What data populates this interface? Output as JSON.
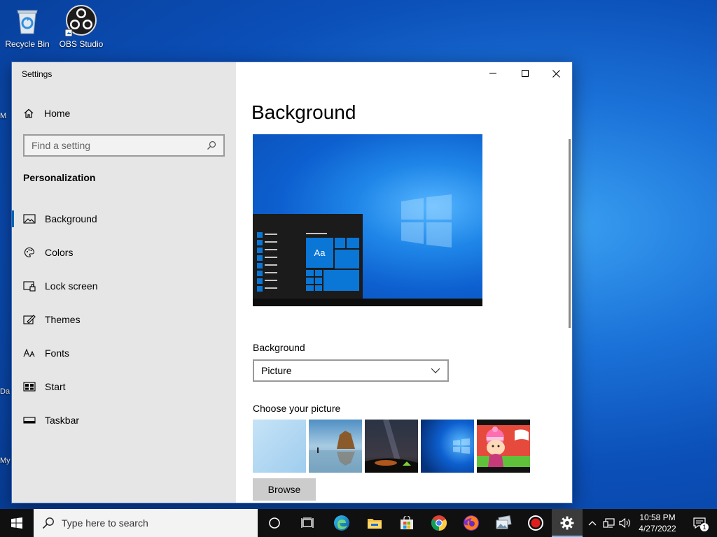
{
  "desktop": {
    "icons": [
      {
        "label": "Recycle Bin",
        "icon": "recycle-bin-icon"
      },
      {
        "label": "OBS Studio",
        "icon": "obs-studio-icon"
      }
    ],
    "edge_labels": [
      "M",
      "Da",
      "My"
    ]
  },
  "window": {
    "title": "Settings",
    "controls": {
      "minimize": "minimize-icon",
      "maximize": "maximize-icon",
      "close": "close-icon"
    }
  },
  "sidebar": {
    "home_label": "Home",
    "search_placeholder": "Find a setting",
    "section_title": "Personalization",
    "items": [
      {
        "label": "Background",
        "icon": "picture-icon",
        "active": true
      },
      {
        "label": "Colors",
        "icon": "palette-icon",
        "active": false
      },
      {
        "label": "Lock screen",
        "icon": "lock-screen-icon",
        "active": false
      },
      {
        "label": "Themes",
        "icon": "themes-icon",
        "active": false
      },
      {
        "label": "Fonts",
        "icon": "fonts-icon",
        "active": false
      },
      {
        "label": "Start",
        "icon": "start-icon",
        "active": false
      },
      {
        "label": "Taskbar",
        "icon": "taskbar-icon",
        "active": false
      }
    ]
  },
  "main": {
    "page_title": "Background",
    "preview_tile_text": "Aa",
    "background_label": "Background",
    "background_value": "Picture",
    "choose_label": "Choose your picture",
    "browse_label": "Browse"
  },
  "taskbar": {
    "search_placeholder": "Type here to search",
    "time": "10:58 PM",
    "date": "4/27/2022",
    "notification_count": "1",
    "accent_color": "#76b9ed"
  }
}
